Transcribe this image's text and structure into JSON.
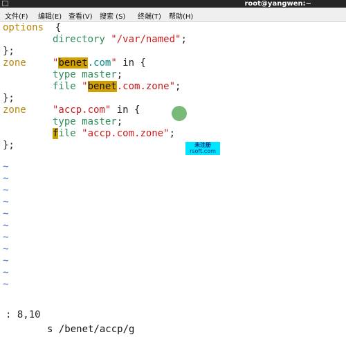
{
  "window": {
    "title": "root@yangwen:~"
  },
  "menu": {
    "items": [
      "文件(F)",
      "编辑(E)",
      "查看(V)",
      "搜索 (S)",
      "终端(T)",
      "帮助(H)"
    ]
  },
  "editor": {
    "l1": {
      "kw": "options",
      "brace": "  {"
    },
    "l2": {
      "key": "directory",
      "str": "\"/var/named\"",
      "semi": ";"
    },
    "l3": {
      "close": "};"
    },
    "l4": {
      "kw": "zone",
      "q1": "\"",
      "name": "benet",
      "dom": ".com",
      "q2": "\"",
      "rest": " in {"
    },
    "l5": {
      "key": "type",
      "val": " master",
      "semi": ";"
    },
    "l6": {
      "key": "file",
      "q1": " \"",
      "name": "benet",
      "rest": ".com.zone\"",
      "semi": ";"
    },
    "l7": {
      "close": "};"
    },
    "l8": {
      "kw": "zone",
      "str": "\"accp.com\"",
      "rest": " in {"
    },
    "l9": {
      "key": "type",
      "val": " master",
      "semi": ";"
    },
    "l10": {
      "cursor": "f",
      "key": "ile",
      "str": " \"accp.com.zone\"",
      "semi": ";"
    },
    "l11": {
      "close": "};"
    },
    "tilde": "~"
  },
  "watermark": {
    "line1": "未注册",
    "line2": "rsoft.com"
  },
  "status": {
    "position": ": 8,10",
    "command": "s /benet/accp/g"
  }
}
